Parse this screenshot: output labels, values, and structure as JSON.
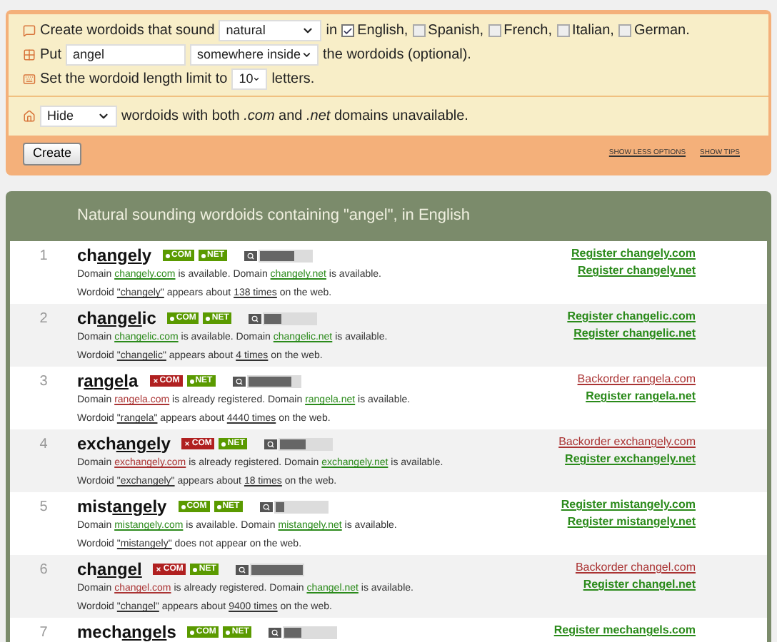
{
  "form": {
    "sound_row": {
      "label": "Create wordoids that sound",
      "select": "natural",
      "in_label": "in",
      "languages": [
        {
          "label": "English,",
          "checked": true
        },
        {
          "label": "Spanish,",
          "checked": false
        },
        {
          "label": "French,",
          "checked": false
        },
        {
          "label": "Italian,",
          "checked": false
        },
        {
          "label": "German.",
          "checked": false
        }
      ]
    },
    "put_row": {
      "label": "Put",
      "value": "angel",
      "position": "somewhere inside",
      "suffix": "the wordoids (optional)."
    },
    "length_row": {
      "label": "Set the wordoid length limit to",
      "value": "10",
      "suffix": "letters."
    },
    "filter_row": {
      "value": "Hide",
      "text": "wordoids with both *.com* and *.net* domains unavailable."
    },
    "create_button": "Create",
    "links": [
      "SHOW LESS OPTIONS",
      "SHOW TIPS"
    ]
  },
  "results": {
    "title": "Natural sounding wordoids containing \"angel\", in English",
    "rows": [
      {
        "number": "1",
        "before": "ch",
        "match": "angel",
        "after": "y",
        "badges": [
          {
            "label": "COM",
            "available": true
          },
          {
            "label": "NET",
            "available": true
          }
        ],
        "level": 0.67,
        "domain_line": [
          {
            "kind": "text",
            "text": "Domain"
          },
          {
            "kind": "domain",
            "text": "changely.com",
            "available": true
          },
          {
            "kind": "text",
            "text": "is available. Domain"
          },
          {
            "kind": "domain",
            "text": "changely.net",
            "available": true
          },
          {
            "kind": "text",
            "text": "is available."
          }
        ],
        "web_line": [
          {
            "kind": "text",
            "text": "Wordoid"
          },
          {
            "kind": "link",
            "text": "\"changely\""
          },
          {
            "kind": "text",
            "text": "appears about"
          },
          {
            "kind": "link",
            "text": "138 times"
          },
          {
            "kind": "text",
            "text": "on the web."
          }
        ],
        "actions": [
          {
            "text": "Register changely.com",
            "kind": "register"
          },
          {
            "text": "Register changely.net",
            "kind": "register"
          }
        ]
      },
      {
        "number": "2",
        "before": "ch",
        "match": "angel",
        "after": "ic",
        "badges": [
          {
            "label": "COM",
            "available": true
          },
          {
            "label": "NET",
            "available": true
          }
        ],
        "level": 0.33,
        "domain_line": [
          {
            "kind": "text",
            "text": "Domain"
          },
          {
            "kind": "domain",
            "text": "changelic.com",
            "available": true
          },
          {
            "kind": "text",
            "text": "is available. Domain"
          },
          {
            "kind": "domain",
            "text": "changelic.net",
            "available": true
          },
          {
            "kind": "text",
            "text": "is available."
          }
        ],
        "web_line": [
          {
            "kind": "text",
            "text": "Wordoid"
          },
          {
            "kind": "link",
            "text": "\"changelic\""
          },
          {
            "kind": "text",
            "text": "appears about"
          },
          {
            "kind": "link",
            "text": "4 times"
          },
          {
            "kind": "text",
            "text": "on the web."
          }
        ],
        "actions": [
          {
            "text": "Register changelic.com",
            "kind": "register"
          },
          {
            "text": "Register changelic.net",
            "kind": "register"
          }
        ]
      },
      {
        "number": "3",
        "before": "r",
        "match": "angel",
        "after": "a",
        "badges": [
          {
            "label": "COM",
            "available": false
          },
          {
            "label": "NET",
            "available": true
          }
        ],
        "level": 0.83,
        "domain_line": [
          {
            "kind": "text",
            "text": "Domain"
          },
          {
            "kind": "domain",
            "text": "rangela.com",
            "available": false
          },
          {
            "kind": "text",
            "text": "is already registered. Domain"
          },
          {
            "kind": "domain",
            "text": "rangela.net",
            "available": true
          },
          {
            "kind": "text",
            "text": "is available."
          }
        ],
        "web_line": [
          {
            "kind": "text",
            "text": "Wordoid"
          },
          {
            "kind": "link",
            "text": "\"rangela\""
          },
          {
            "kind": "text",
            "text": "appears about"
          },
          {
            "kind": "link",
            "text": "4440 times"
          },
          {
            "kind": "text",
            "text": "on the web."
          }
        ],
        "actions": [
          {
            "text": "Backorder rangela.com",
            "kind": "backorder"
          },
          {
            "text": "Register rangela.net",
            "kind": "register"
          }
        ]
      },
      {
        "number": "4",
        "before": "exch",
        "match": "angel",
        "after": "y",
        "badges": [
          {
            "label": "COM",
            "available": false
          },
          {
            "label": "NET",
            "available": true
          }
        ],
        "level": 0.5,
        "domain_line": [
          {
            "kind": "text",
            "text": "Domain"
          },
          {
            "kind": "domain",
            "text": "exchangely.com",
            "available": false
          },
          {
            "kind": "text",
            "text": "is already registered. Domain"
          },
          {
            "kind": "domain",
            "text": "exchangely.net",
            "available": true
          },
          {
            "kind": "text",
            "text": "is available."
          }
        ],
        "web_line": [
          {
            "kind": "text",
            "text": "Wordoid"
          },
          {
            "kind": "link",
            "text": "\"exchangely\""
          },
          {
            "kind": "text",
            "text": "appears about"
          },
          {
            "kind": "link",
            "text": "18 times"
          },
          {
            "kind": "text",
            "text": "on the web."
          }
        ],
        "actions": [
          {
            "text": "Backorder exchangely.com",
            "kind": "backorder"
          },
          {
            "text": "Register exchangely.net",
            "kind": "register"
          }
        ]
      },
      {
        "number": "5",
        "before": "mist",
        "match": "angel",
        "after": "y",
        "badges": [
          {
            "label": "COM",
            "available": true
          },
          {
            "label": "NET",
            "available": true
          }
        ],
        "level": 0.17,
        "domain_line": [
          {
            "kind": "text",
            "text": "Domain"
          },
          {
            "kind": "domain",
            "text": "mistangely.com",
            "available": true
          },
          {
            "kind": "text",
            "text": "is available. Domain"
          },
          {
            "kind": "domain",
            "text": "mistangely.net",
            "available": true
          },
          {
            "kind": "text",
            "text": "is available."
          }
        ],
        "web_line": [
          {
            "kind": "text",
            "text": "Wordoid"
          },
          {
            "kind": "link",
            "text": "\"mistangely\""
          },
          {
            "kind": "text",
            "text": "does not appear on the web."
          }
        ],
        "actions": [
          {
            "text": "Register mistangely.com",
            "kind": "register"
          },
          {
            "text": "Register mistangely.net",
            "kind": "register"
          }
        ]
      },
      {
        "number": "6",
        "before": "ch",
        "match": "angel",
        "after": "",
        "badges": [
          {
            "label": "COM",
            "available": false
          },
          {
            "label": "NET",
            "available": true
          }
        ],
        "level": 1,
        "domain_line": [
          {
            "kind": "text",
            "text": "Domain"
          },
          {
            "kind": "domain",
            "text": "changel.com",
            "available": false
          },
          {
            "kind": "text",
            "text": "is already registered. Domain"
          },
          {
            "kind": "domain",
            "text": "changel.net",
            "available": true
          },
          {
            "kind": "text",
            "text": "is available."
          }
        ],
        "web_line": [
          {
            "kind": "text",
            "text": "Wordoid"
          },
          {
            "kind": "link",
            "text": "\"changel\""
          },
          {
            "kind": "text",
            "text": "appears about"
          },
          {
            "kind": "link",
            "text": "9400 times"
          },
          {
            "kind": "text",
            "text": "on the web."
          }
        ],
        "actions": [
          {
            "text": "Backorder changel.com",
            "kind": "backorder"
          },
          {
            "text": "Register changel.net",
            "kind": "register"
          }
        ]
      },
      {
        "number": "7",
        "before": "mech",
        "match": "angel",
        "after": "s",
        "badges": [
          {
            "label": "COM",
            "available": true
          },
          {
            "label": "NET",
            "available": true
          }
        ],
        "level": 0.33,
        "actions": [
          {
            "text": "Register mechangels.com",
            "kind": "register"
          }
        ]
      }
    ]
  }
}
